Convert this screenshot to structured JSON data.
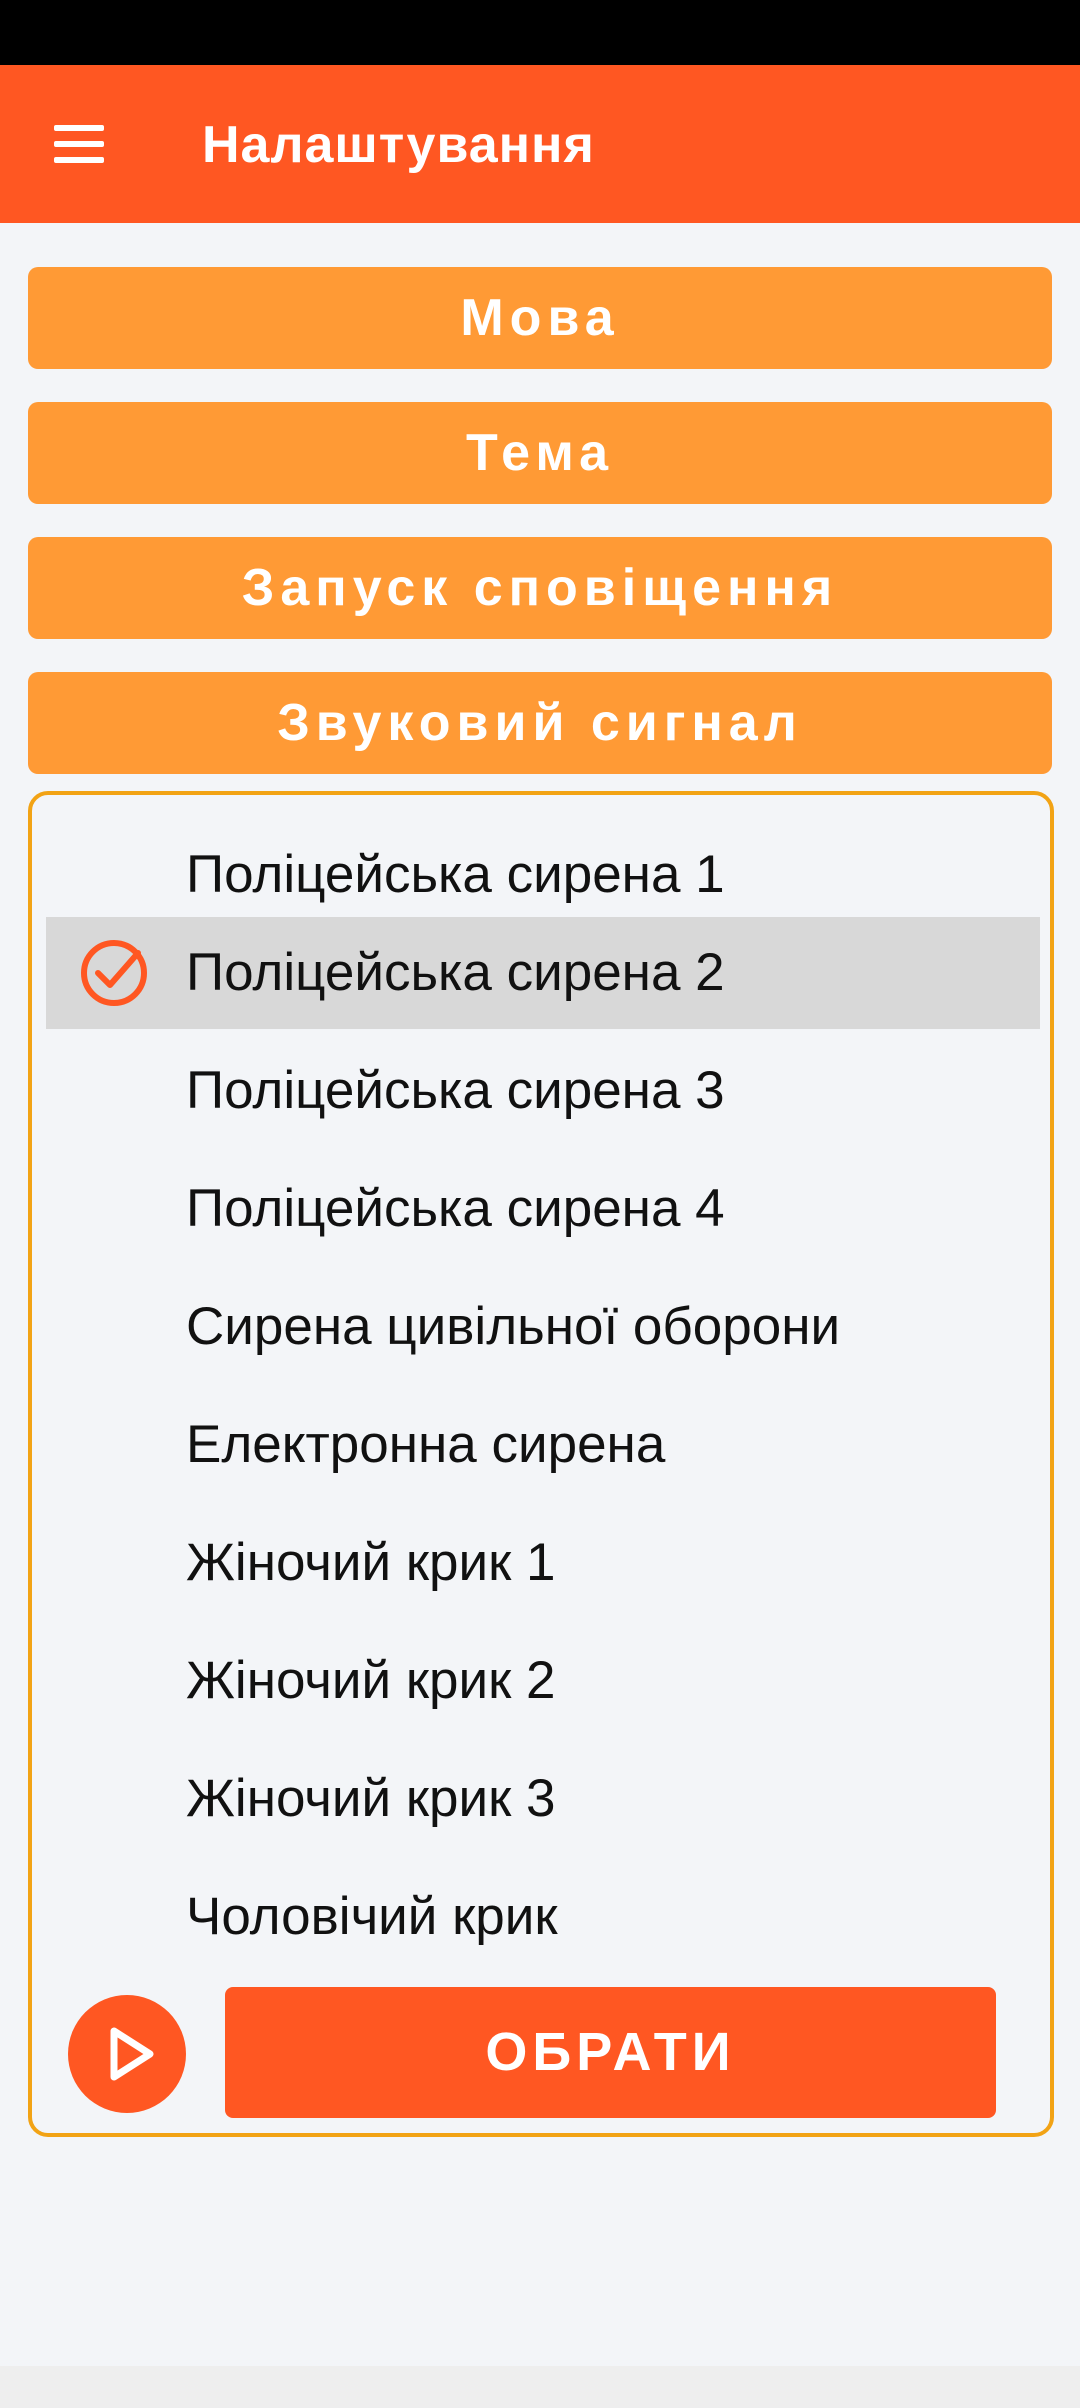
{
  "app_bar": {
    "title": "Налаштування",
    "menu_icon": "hamburger-menu-icon",
    "background": "#FF5722"
  },
  "settings_buttons": [
    {
      "label": "Мова"
    },
    {
      "label": "Тема"
    },
    {
      "label": "Запуск сповіщення"
    },
    {
      "label": "Звуковий сигнал"
    }
  ],
  "sound_list": {
    "selected_index": 1,
    "items": [
      {
        "label": "Поліцейська сирена 1",
        "selected": false
      },
      {
        "label": "Поліцейська сирена 2",
        "selected": true
      },
      {
        "label": "Поліцейська сирена 3",
        "selected": false
      },
      {
        "label": "Поліцейська сирена 4",
        "selected": false
      },
      {
        "label": "Сирена цивільної оборони",
        "selected": false
      },
      {
        "label": "Електронна сирена",
        "selected": false
      },
      {
        "label": "Жіночий крик 1",
        "selected": false
      },
      {
        "label": "Жіночий крик 2",
        "selected": false
      },
      {
        "label": "Жіночий крик 3",
        "selected": false
      },
      {
        "label": "Чоловічий крик",
        "selected": false
      }
    ]
  },
  "actions": {
    "play_icon": "play-icon",
    "choose_label": "ОБРАТИ"
  },
  "colors": {
    "accent": "#FF5722",
    "button": "#FF9A35",
    "panel_border": "#F2A315",
    "selected_row": "#D8D8D8",
    "background": "#F3F5F8"
  }
}
